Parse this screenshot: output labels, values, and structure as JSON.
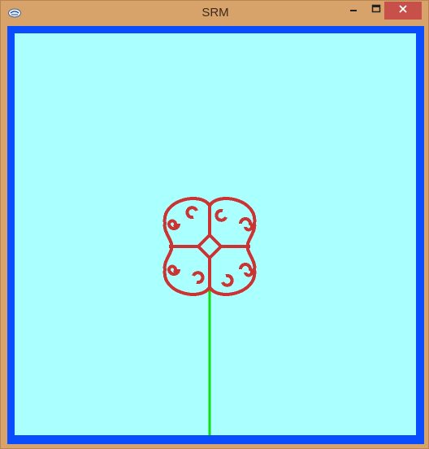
{
  "window": {
    "title": "SRM",
    "icon": "app-logo-icon",
    "controls": [
      "minimize-icon",
      "maximize-icon",
      "close-icon"
    ]
  },
  "colors": {
    "frame": "#d8a26b",
    "border": "#0a4dff",
    "background": "#aaffff",
    "stem": "#11dd11",
    "fractal": "#cc3333",
    "close_button": "#c7504b"
  },
  "scene": {
    "stem": "green-line",
    "fractal": "red-curl-fractal"
  }
}
